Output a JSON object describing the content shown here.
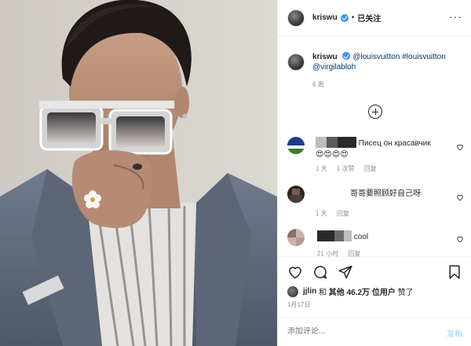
{
  "post": {
    "username": "kriswu",
    "follow_status": "已关注",
    "separator": "•",
    "more_icon": "more-options-icon"
  },
  "caption": {
    "username": "kriswu",
    "mention1": "@louisvuitton",
    "hashtag": "#louisvuitton",
    "mention2": "@virgilabloh",
    "time": "6 周",
    "load_more_icon": "plus-circle-icon"
  },
  "comments": [
    {
      "text": "Писец он красавчик",
      "emojis": "😍😍😍😍",
      "time": "1 天",
      "likes": "1 次赞",
      "reply": "回复"
    },
    {
      "text": "哥哥要照顾好自己呀",
      "time": "1 天",
      "reply": "回复"
    },
    {
      "text": "cool",
      "time": "21 小时",
      "reply": "回复"
    }
  ],
  "actions": {
    "like_icon": "heart-icon",
    "comment_icon": "comment-icon",
    "share_icon": "paper-plane-icon",
    "save_icon": "bookmark-icon"
  },
  "likes": {
    "user": "jjlin",
    "mid": " 和 ",
    "count": "其他 46.2万 位用户",
    "suffix": " 赞了"
  },
  "date": "1月17日",
  "add_comment": {
    "placeholder": "添加评论...",
    "post_label": "发布"
  },
  "colors": {
    "verified": "#3897f0",
    "tag": "#003569",
    "meta": "#8e8e8e",
    "post_disabled": "#b2dffc",
    "border": "#efefef"
  }
}
